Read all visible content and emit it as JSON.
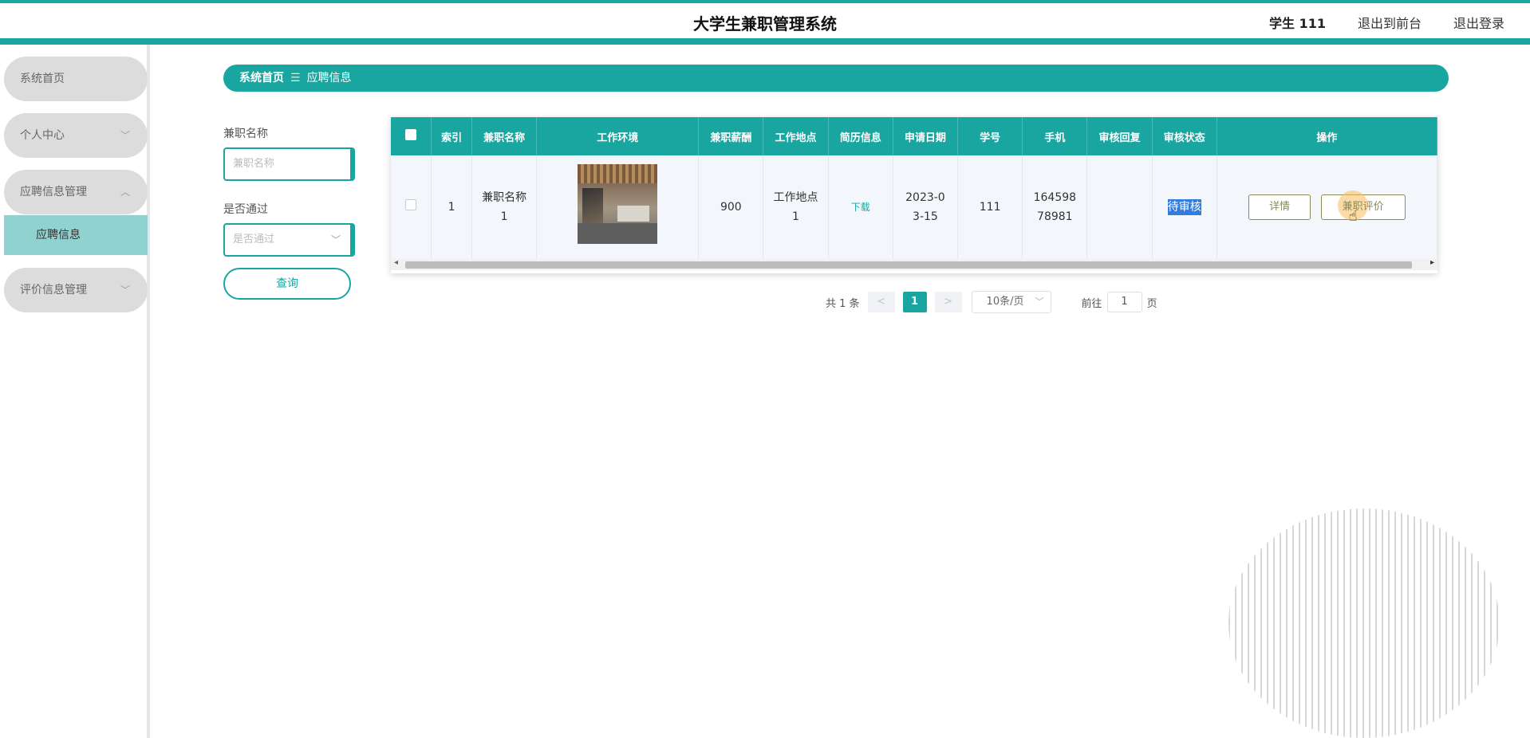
{
  "header": {
    "title": "大学生兼职管理系统",
    "user": "学生 111",
    "back_to_front": "退出到前台",
    "logout": "退出登录"
  },
  "sidebar": {
    "items": [
      {
        "label": "系统首页",
        "chevron": ""
      },
      {
        "label": "个人中心",
        "chevron": "﹀"
      },
      {
        "label": "应聘信息管理",
        "chevron": "︿"
      },
      {
        "label": "评价信息管理",
        "chevron": "﹀"
      }
    ],
    "active_sub": "应聘信息"
  },
  "breadcrumb": {
    "home": "系统首页",
    "separator": "☰",
    "current": "应聘信息"
  },
  "filters": {
    "name_label": "兼职名称",
    "name_placeholder": "兼职名称",
    "pass_label": "是否通过",
    "pass_placeholder": "是否通过",
    "query_button": "查询"
  },
  "table": {
    "headers": [
      "索引",
      "兼职名称",
      "工作环境",
      "兼职薪酬",
      "工作地点",
      "简历信息",
      "申请日期",
      "学号",
      "手机",
      "审核回复",
      "审核状态",
      "操作"
    ],
    "rows": [
      {
        "index": "1",
        "name": "兼职名称1",
        "salary": "900",
        "location": "工作地点1",
        "resume": "下载",
        "date": "2023-03-15",
        "student_id": "111",
        "phone": "16459878981",
        "reply": "",
        "status": "待审核",
        "detail_btn": "详情",
        "review_btn": "兼职评价"
      }
    ]
  },
  "pagination": {
    "total": "共 1 条",
    "prev": "<",
    "current_page": "1",
    "next": ">",
    "page_size": "10条/页",
    "goto_label": "前往",
    "goto_value": "1",
    "page_suffix": "页"
  },
  "colors": {
    "accent": "#1aa6a0",
    "status_highlight": "#2f7de1"
  }
}
